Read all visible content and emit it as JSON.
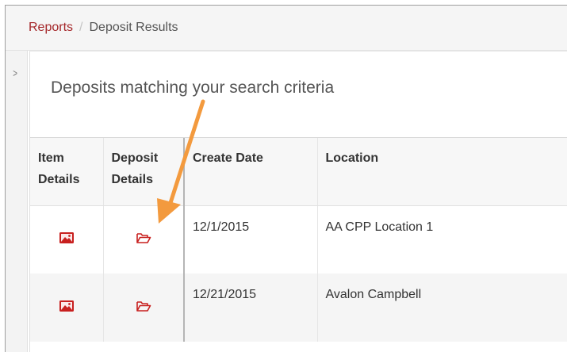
{
  "breadcrumb": {
    "reports_label": "Reports",
    "separator": "/",
    "current": "Deposit Results"
  },
  "page": {
    "title": "Deposits matching your search criteria"
  },
  "table": {
    "headers": {
      "item_details": [
        "Item",
        "Details"
      ],
      "deposit_details": [
        "Deposit",
        "Details"
      ],
      "create_date": "Create Date",
      "location": "Location"
    },
    "rows": [
      {
        "create_date": "12/1/2015",
        "location": "AA CPP Location 1",
        "item_icon": "image-icon",
        "deposit_icon": "folder-open-icon"
      },
      {
        "create_date": "12/21/2015",
        "location": "Avalon Campbell",
        "item_icon": "image-icon",
        "deposit_icon": "folder-open-icon"
      }
    ]
  },
  "colors": {
    "accent_red": "#a5282b",
    "icon_red": "#c8201f",
    "annotation_arrow": "#f39a3e"
  },
  "sidebar": {
    "toggle_icon": "chevron-right-icon"
  }
}
